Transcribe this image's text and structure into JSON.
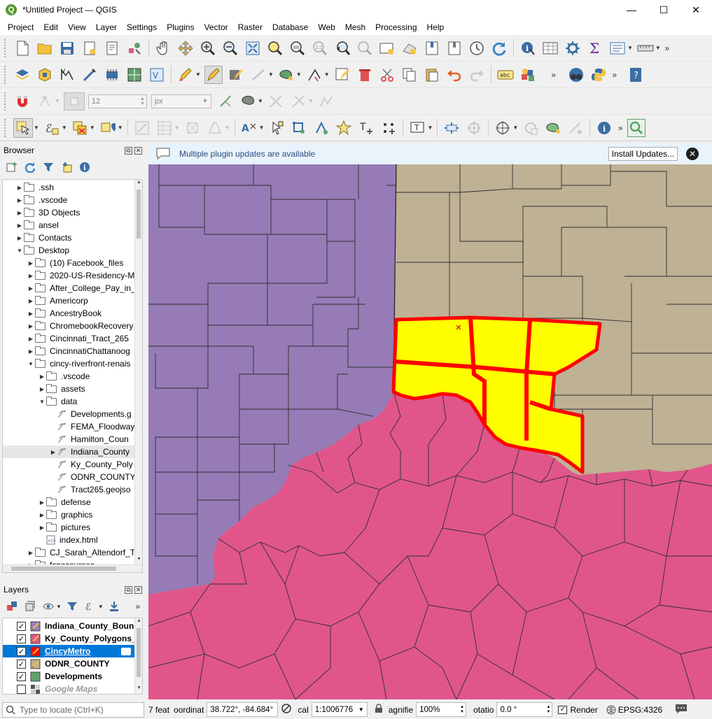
{
  "window": {
    "title": "*Untitled Project — QGIS",
    "minimize": "—",
    "maximize": "☐",
    "close": "✕"
  },
  "menu": [
    "Project",
    "Edit",
    "View",
    "Layer",
    "Settings",
    "Plugins",
    "Vector",
    "Raster",
    "Database",
    "Web",
    "Mesh",
    "Processing",
    "Help"
  ],
  "snapping": {
    "tolerance_value": "12",
    "unit": "px"
  },
  "browser": {
    "title": "Browser",
    "items": [
      {
        "label": ".ssh",
        "depth": 1,
        "kind": "folder",
        "arrow": "▶"
      },
      {
        "label": ".vscode",
        "depth": 1,
        "kind": "folder",
        "arrow": "▶"
      },
      {
        "label": "3D Objects",
        "depth": 1,
        "kind": "folder",
        "arrow": "▶"
      },
      {
        "label": "ansel",
        "depth": 1,
        "kind": "folder",
        "arrow": "▶"
      },
      {
        "label": "Contacts",
        "depth": 1,
        "kind": "folder",
        "arrow": "▶"
      },
      {
        "label": "Desktop",
        "depth": 1,
        "kind": "folder",
        "arrow": "▼"
      },
      {
        "label": "(10) Facebook_files",
        "depth": 2,
        "kind": "folder",
        "arrow": "▶"
      },
      {
        "label": "2020-US-Residency-M",
        "depth": 2,
        "kind": "folder",
        "arrow": "▶"
      },
      {
        "label": "After_College_Pay_in_",
        "depth": 2,
        "kind": "folder",
        "arrow": "▶"
      },
      {
        "label": "Americorp",
        "depth": 2,
        "kind": "folder",
        "arrow": "▶"
      },
      {
        "label": "AncestryBook",
        "depth": 2,
        "kind": "folder",
        "arrow": "▶"
      },
      {
        "label": "ChromebookRecovery",
        "depth": 2,
        "kind": "folder",
        "arrow": "▶"
      },
      {
        "label": "Cincinnati_Tract_265",
        "depth": 2,
        "kind": "folder",
        "arrow": "▶"
      },
      {
        "label": "CincinnatiChattanoog",
        "depth": 2,
        "kind": "folder",
        "arrow": "▶"
      },
      {
        "label": "cincy-riverfront-renais",
        "depth": 2,
        "kind": "folder",
        "arrow": "▼"
      },
      {
        "label": ".vscode",
        "depth": 3,
        "kind": "folder",
        "arrow": "▶"
      },
      {
        "label": "assets",
        "depth": 3,
        "kind": "folder",
        "arrow": "▶"
      },
      {
        "label": "data",
        "depth": 3,
        "kind": "folder",
        "arrow": "▼"
      },
      {
        "label": "Developments.g",
        "depth": 4,
        "kind": "vector",
        "arrow": ""
      },
      {
        "label": "FEMA_Floodway",
        "depth": 4,
        "kind": "vector",
        "arrow": ""
      },
      {
        "label": "Hamilton_Coun",
        "depth": 4,
        "kind": "vector",
        "arrow": ""
      },
      {
        "label": "Indiana_County",
        "depth": 4,
        "kind": "vector",
        "arrow": "▶",
        "selected": true
      },
      {
        "label": "Ky_County_Poly",
        "depth": 4,
        "kind": "vector",
        "arrow": ""
      },
      {
        "label": "ODNR_COUNTY",
        "depth": 4,
        "kind": "vector",
        "arrow": ""
      },
      {
        "label": "Tract265.geojso",
        "depth": 4,
        "kind": "vector",
        "arrow": ""
      },
      {
        "label": "defense",
        "depth": 3,
        "kind": "folder",
        "arrow": "▶"
      },
      {
        "label": "graphics",
        "depth": 3,
        "kind": "folder",
        "arrow": "▶"
      },
      {
        "label": "pictures",
        "depth": 3,
        "kind": "folder",
        "arrow": "▶"
      },
      {
        "label": "index.html",
        "depth": 3,
        "kind": "html",
        "arrow": ""
      },
      {
        "label": "CJ_Sarah_Altendorf_Tr",
        "depth": 2,
        "kind": "folder",
        "arrow": "▶"
      },
      {
        "label": "fcpscourses",
        "depth": 2,
        "kind": "folder",
        "arrow": "▶"
      }
    ]
  },
  "layers": {
    "title": "Layers",
    "items": [
      {
        "label": "Indiana_County_Bound",
        "checked": true,
        "symbol": "line",
        "color": "#9b7fbf"
      },
      {
        "label": "Ky_County_Polygons_V",
        "checked": true,
        "symbol": "line",
        "color": "#e0568b"
      },
      {
        "label": "CincyMetro",
        "checked": true,
        "symbol": "line",
        "color": "#ff0000",
        "selected": true
      },
      {
        "label": "ODNR_COUNTY",
        "checked": true,
        "symbol": "line",
        "color": "#c0b08f"
      },
      {
        "label": "Developments",
        "checked": true,
        "symbol": "fill",
        "color": "#5fa16a"
      },
      {
        "label": "Google Maps",
        "checked": false,
        "symbol": "tile",
        "color": "#888888"
      }
    ]
  },
  "message_bar": {
    "text": "Multiple plugin updates are available",
    "button": "Install Updates...",
    "close": "✕"
  },
  "map": {
    "colors": {
      "indiana": "#967bb6",
      "ohio": "#bfb194",
      "kentucky": "#e0568b",
      "selection_fill": "#ffff00",
      "selection_outline": "#ff0000",
      "border": "#3a3a3a"
    }
  },
  "status": {
    "locator_placeholder": "Type to locate (Ctrl+K)",
    "features": "7 feat",
    "coordinate_label": "oordinat",
    "coordinate": "38.722°, -84.684°",
    "scale_label": "cal",
    "scale": "1:1006776",
    "magnifier_label": "agnifie",
    "magnifier": "100%",
    "rotation_label": "otatio",
    "rotation": "0.0 °",
    "render_label": "Render",
    "crs": "EPSG:4326"
  }
}
